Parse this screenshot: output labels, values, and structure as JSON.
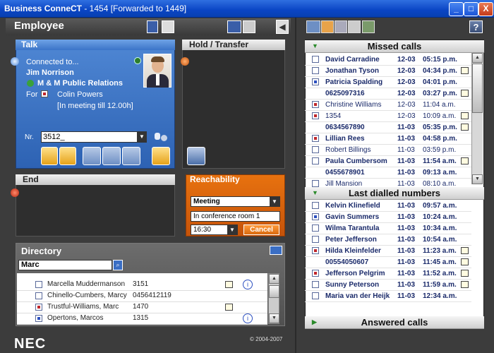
{
  "window": {
    "title": "Business ConneCT",
    "subtitle": " - 1454 [Forwarded to 1449]",
    "minimize": "_",
    "maximize": "□",
    "close": "X"
  },
  "employee": {
    "title": "Employee"
  },
  "talk": {
    "header": "Talk",
    "connected": "Connected to...",
    "name": "Jim Norrison",
    "company": "M & M Public Relations",
    "for_label": "For",
    "for_name": "Colin Powers",
    "status": "[In meeting till 12.00h]",
    "nr_label": "Nr.",
    "nr_value": "3512_"
  },
  "hold": {
    "header": "Hold / Transfer"
  },
  "end": {
    "header": "End"
  },
  "reachability": {
    "header": "Reachability",
    "selected": "Meeting",
    "note": "In conference room 1",
    "time": "16:30",
    "cancel": "Cancel"
  },
  "directory": {
    "title": "Directory",
    "search": "Marc",
    "rows": [
      {
        "name": "Marcella Muddermanson",
        "number": "3151"
      },
      {
        "name": "Chinello-Cumbers, Marcy",
        "number": "0456412119"
      },
      {
        "name": "Trustful-Williams, Marc",
        "number": "1470"
      },
      {
        "name": "Opertons, Marcos",
        "number": "1315"
      }
    ]
  },
  "footer": {
    "logo": "NEC",
    "copyright": "© 2004-2007"
  },
  "help": "?",
  "missed": {
    "header": "Missed calls",
    "rows": [
      {
        "name": "David Carradine",
        "date": "12-03",
        "time": "05:15 p.m."
      },
      {
        "name": "Jonathan Tyson",
        "date": "12-03",
        "time": "04:34 p.m."
      },
      {
        "name": "Patricia Spalding",
        "date": "12-03",
        "time": "04:01 p.m."
      },
      {
        "name": "0625097316",
        "date": "12-03",
        "time": "03:27 p.m."
      },
      {
        "name": "Christine Williams",
        "date": "12-03",
        "time": "11:04 a.m."
      },
      {
        "name": "1354",
        "date": "12-03",
        "time": "10:09 a.m."
      },
      {
        "name": "0634567890",
        "date": "11-03",
        "time": "05:35 p.m."
      },
      {
        "name": "Lillian Rees",
        "date": "11-03",
        "time": "04:58 p.m."
      },
      {
        "name": "Robert Billings",
        "date": "11-03",
        "time": "03:59 p.m."
      },
      {
        "name": "Paula Cumbersom",
        "date": "11-03",
        "time": "11:54 a.m."
      },
      {
        "name": "0455678901",
        "date": "11-03",
        "time": "09:13 a.m."
      },
      {
        "name": "Jill Mansion",
        "date": "11-03",
        "time": "08:10 a.m."
      }
    ]
  },
  "dialled": {
    "header": "Last dialled numbers",
    "rows": [
      {
        "name": "Kelvin Klinefield",
        "date": "11-03",
        "time": "09:57 a.m."
      },
      {
        "name": "Gavin Summers",
        "date": "11-03",
        "time": "10:24 a.m."
      },
      {
        "name": "Wilma Tarantula",
        "date": "11-03",
        "time": "10:34 a.m."
      },
      {
        "name": "Peter Jefferson",
        "date": "11-03",
        "time": "10:54 a.m."
      },
      {
        "name": "Hilda Kleinfelder",
        "date": "11-03",
        "time": "11:23 a.m."
      },
      {
        "name": "00554050607",
        "date": "11-03",
        "time": "11:45 a.m."
      },
      {
        "name": "Jefferson Pelgrim",
        "date": "11-03",
        "time": "11:52 a.m."
      },
      {
        "name": "Sunny Peterson",
        "date": "11-03",
        "time": "11:59 a.m."
      },
      {
        "name": "Maria van der Heijk",
        "date": "11-03",
        "time": "12:34 a.m."
      }
    ]
  },
  "answered": {
    "header": "Answered calls"
  }
}
